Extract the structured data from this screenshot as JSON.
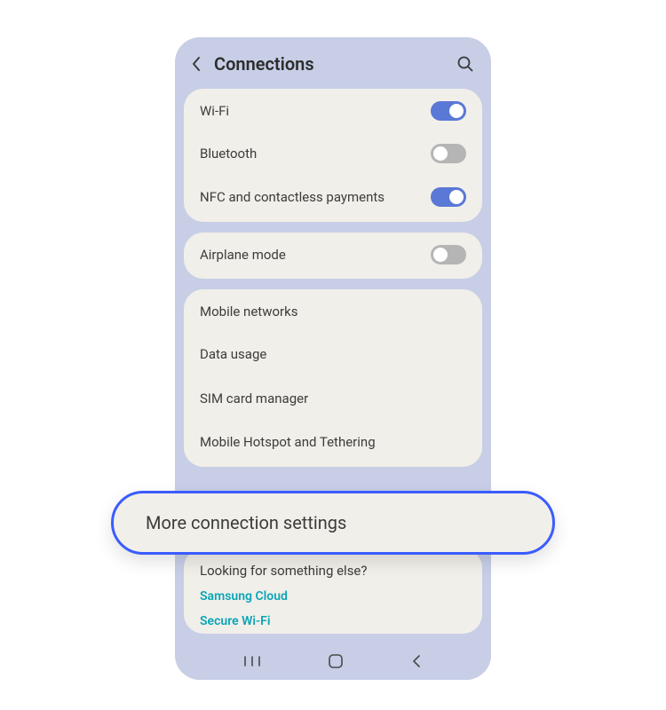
{
  "header": {
    "title": "Connections"
  },
  "groups": [
    {
      "items": [
        {
          "label": "Wi-Fi",
          "toggle": true,
          "on": true
        },
        {
          "label": "Bluetooth",
          "toggle": true,
          "on": false
        },
        {
          "label": "NFC and contactless payments",
          "toggle": true,
          "on": true
        }
      ]
    },
    {
      "items": [
        {
          "label": "Airplane mode",
          "toggle": true,
          "on": false
        }
      ]
    },
    {
      "items": [
        {
          "label": "Mobile networks",
          "toggle": false
        },
        {
          "label": "Data usage",
          "toggle": false
        },
        {
          "label": "SIM card manager",
          "toggle": false
        },
        {
          "label": "Mobile Hotspot and Tethering",
          "toggle": false
        }
      ]
    }
  ],
  "highlight": {
    "label": "More connection settings"
  },
  "footer": {
    "prompt": "Looking for something else?",
    "links": [
      "Samsung Cloud",
      "Secure Wi-Fi"
    ]
  }
}
